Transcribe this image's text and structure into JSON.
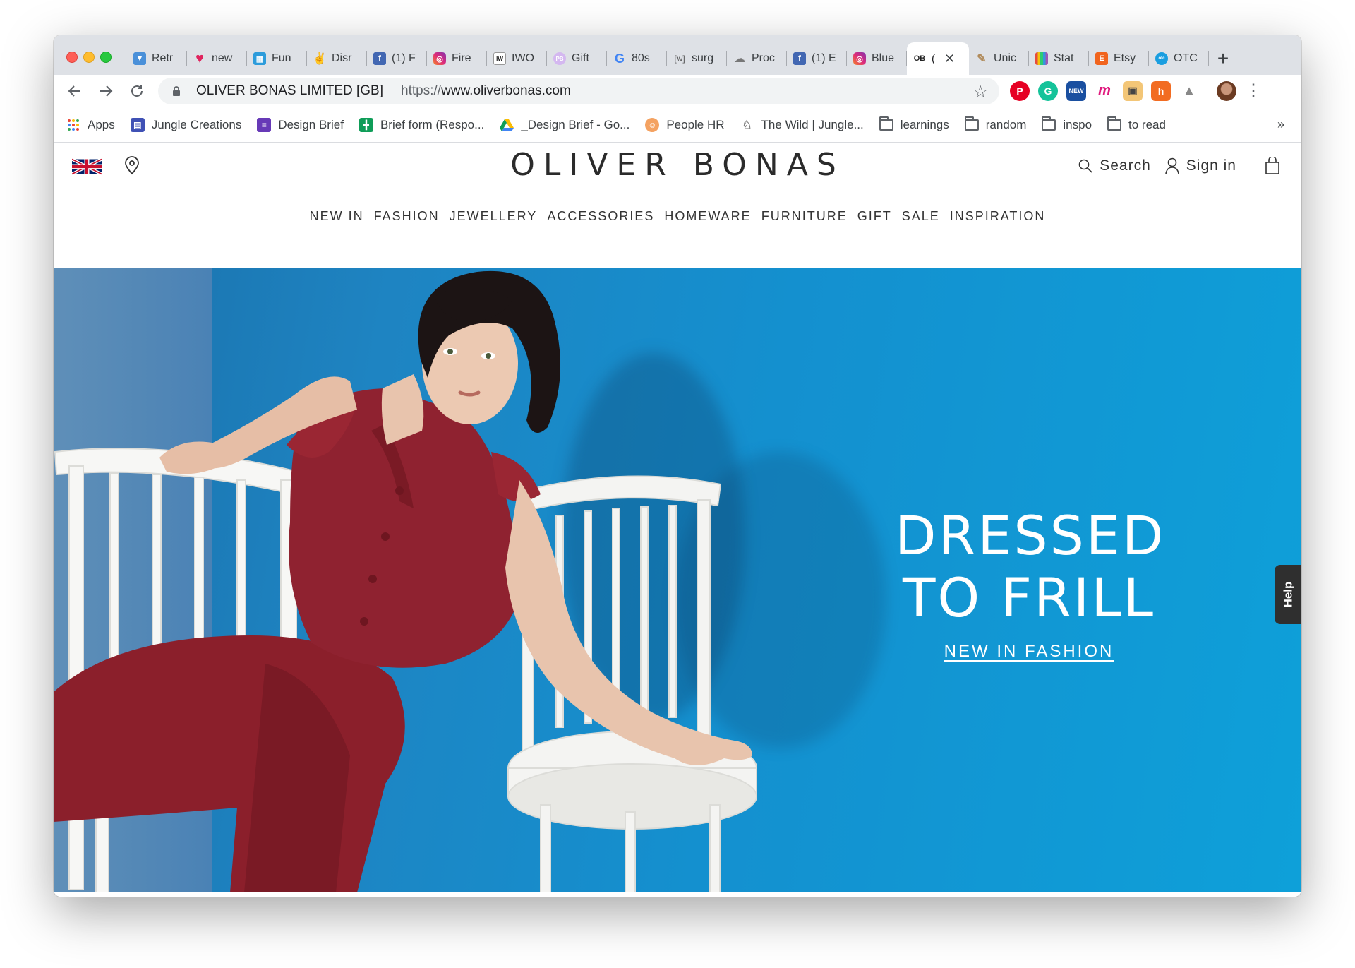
{
  "browser": {
    "tabs": [
      {
        "title": "Retr",
        "icon": "tshirt-icon",
        "color": "#4a90d9"
      },
      {
        "title": "new",
        "icon": "heart-icon",
        "color": "#e0245e"
      },
      {
        "title": "Fun",
        "icon": "fun-icon",
        "color": "#2d9cdb"
      },
      {
        "title": "Disr",
        "icon": "peace-hand-icon",
        "color": "#f2c94c"
      },
      {
        "title": "(1) F",
        "icon": "facebook-icon",
        "color": "#4267b2"
      },
      {
        "title": "Fire",
        "icon": "instagram-icon",
        "color": "#c13584"
      },
      {
        "title": "IWO",
        "icon": "iw-icon",
        "color": "#222222"
      },
      {
        "title": "Gift",
        "icon": "pb-icon",
        "color": "#d4b8f0"
      },
      {
        "title": "80s",
        "icon": "google-icon",
        "color": "#4285f4"
      },
      {
        "title": "surg",
        "icon": "w-bracket-icon",
        "color": "#555555"
      },
      {
        "title": "Proc",
        "icon": "cloud-icon",
        "color": "#777777"
      },
      {
        "title": "(1) E",
        "icon": "facebook-icon",
        "color": "#4267b2"
      },
      {
        "title": "Blue",
        "icon": "instagram-icon",
        "color": "#c13584"
      },
      {
        "title": "OB",
        "icon": "ob-icon",
        "color": "#222222",
        "active": true
      },
      {
        "title": "Unic",
        "icon": "pencil-icon",
        "color": "#b08a5a"
      },
      {
        "title": "Stat",
        "icon": "stripes-icon",
        "color": "#e74c3c"
      },
      {
        "title": "Etsy",
        "icon": "etsy-icon",
        "color": "#f1641e"
      },
      {
        "title": "OTC",
        "icon": "otc-icon",
        "color": "#1a9ee0"
      }
    ],
    "active_tab_label": "OB (",
    "omnibox": {
      "site_identity": "OLIVER BONAS LIMITED [GB]",
      "url_scheme": "https://",
      "url_host": "www.oliverbonas.com"
    },
    "bookmarks": [
      {
        "label": "Apps",
        "icon": "apps-grid-icon"
      },
      {
        "label": "Jungle Creations",
        "icon": "jungle-creations-icon",
        "color": "#3f51b5"
      },
      {
        "label": "Design Brief",
        "icon": "forms-icon",
        "color": "#673ab7"
      },
      {
        "label": "Brief form (Respo...",
        "icon": "sheets-icon",
        "color": "#0f9d58"
      },
      {
        "label": "_Design Brief - Go...",
        "icon": "drive-icon",
        "color": "#fbbc04"
      },
      {
        "label": "People HR",
        "icon": "people-hr-icon",
        "color": "#f4a261"
      },
      {
        "label": "The Wild | Jungle...",
        "icon": "wild-icon"
      },
      {
        "label": "learnings",
        "icon": "folder-icon"
      },
      {
        "label": "random",
        "icon": "folder-icon"
      },
      {
        "label": "inspo",
        "icon": "folder-icon"
      },
      {
        "label": "to read",
        "icon": "folder-icon"
      }
    ],
    "bookmarks_overflow": "»"
  },
  "site": {
    "logo": "OLIVER BONAS",
    "header": {
      "search_label": "Search",
      "signin_label": "Sign in"
    },
    "nav": [
      "NEW IN",
      "FASHION",
      "JEWELLERY",
      "ACCESSORIES",
      "HOMEWARE",
      "FURNITURE",
      "GIFT",
      "SALE",
      "INSPIRATION"
    ],
    "hero": {
      "title": "DRESSED\nTO FRILL",
      "cta": "NEW IN FASHION"
    },
    "help_tab": "Help"
  },
  "colors": {
    "hero_blue": "#1490cf",
    "dress_red": "#8b1f2b",
    "logo_text": "#2b2b2b"
  }
}
